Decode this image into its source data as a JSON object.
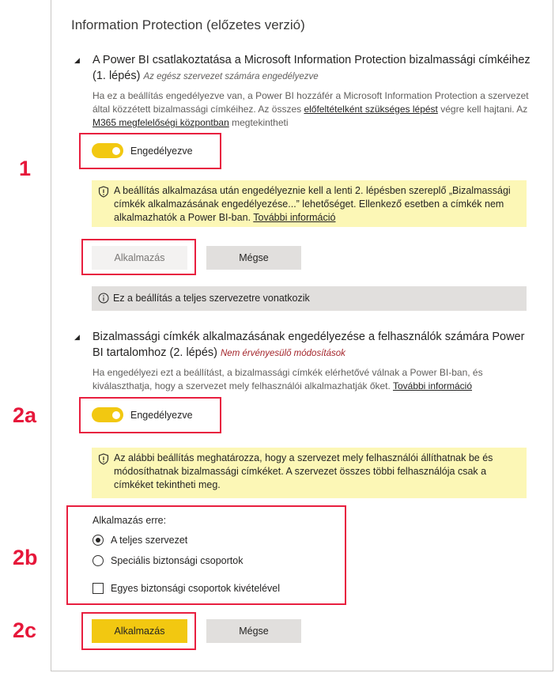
{
  "panel_title": "Information Protection (előzetes verzió)",
  "callouts": {
    "c1": "1",
    "c2a": "2a",
    "c2b": "2b",
    "c2c": "2c"
  },
  "section1": {
    "title": "A Power BI csatlakoztatása a Microsoft Information Protection bizalmassági címkéihez (1. lépés)",
    "note": "Az egész szervezet számára engedélyezve",
    "desc_prefix": "Ha ez a beállítás engedélyezve van, a Power BI hozzáfér a Microsoft Information Protection a szervezet által közzétett bizalmassági címkéihez. Az összes ",
    "desc_link1": "előfeltételként szükséges lépést",
    "desc_mid": " végre kell hajtani. Az ",
    "desc_link2": "M365 megfelelőségi központban",
    "desc_suffix": " megtekintheti",
    "toggle_label": "Engedélyezve",
    "toggle_on": true,
    "warning_text": "A beállítás alkalmazása után engedélyeznie kell a lenti 2. lépésben szereplő „Bizalmassági címkék alkalmazásának engedélyezése...” lehetőséget. Ellenkező esetben a címkék nem alkalmazhatók a Power BI-ban. ",
    "warning_link": "További információ",
    "apply_label": "Alkalmazás",
    "cancel_label": "Mégse",
    "info_text": "Ez a beállítás a teljes szervezetre vonatkozik"
  },
  "section2": {
    "title": "Bizalmassági címkék alkalmazásának engedélyezése a felhasználók számára Power BI tartalomhoz (2. lépés)",
    "note": "Nem érvényesülő módosítások",
    "desc": "Ha engedélyezi ezt a beállítást, a bizalmassági címkék elérhetővé válnak a Power BI-ban, és kiválaszthatja, hogy a szervezet mely felhasználói alkalmazhatják őket. ",
    "desc_link": "További információ",
    "toggle_label": "Engedélyezve",
    "toggle_on": true,
    "warning_text": "Az alábbi beállítás meghatározza, hogy a szervezet mely felhasználói állíthatnak be és módosíthatnak bizalmassági címkéket. A szervezet összes többi felhasználója csak a címkéket tekintheti meg.",
    "apply_to_label": "Alkalmazás erre:",
    "radio_options": [
      "A teljes szervezet",
      "Speciális biztonsági csoportok"
    ],
    "selected_option": "A teljes szervezet",
    "except_label": "Egyes biztonsági csoportok kivételével",
    "except_checked": false,
    "apply_label": "Alkalmazás",
    "cancel_label": "Mégse"
  },
  "colors": {
    "accent": "#f2c811",
    "callout": "#e6173a",
    "warning_bg": "#fcf7b6",
    "info_bg": "#e1dfdd"
  },
  "icons": {
    "collapse": "triangle-down-icon",
    "warning": "shield-warning-icon",
    "info": "info-icon"
  }
}
